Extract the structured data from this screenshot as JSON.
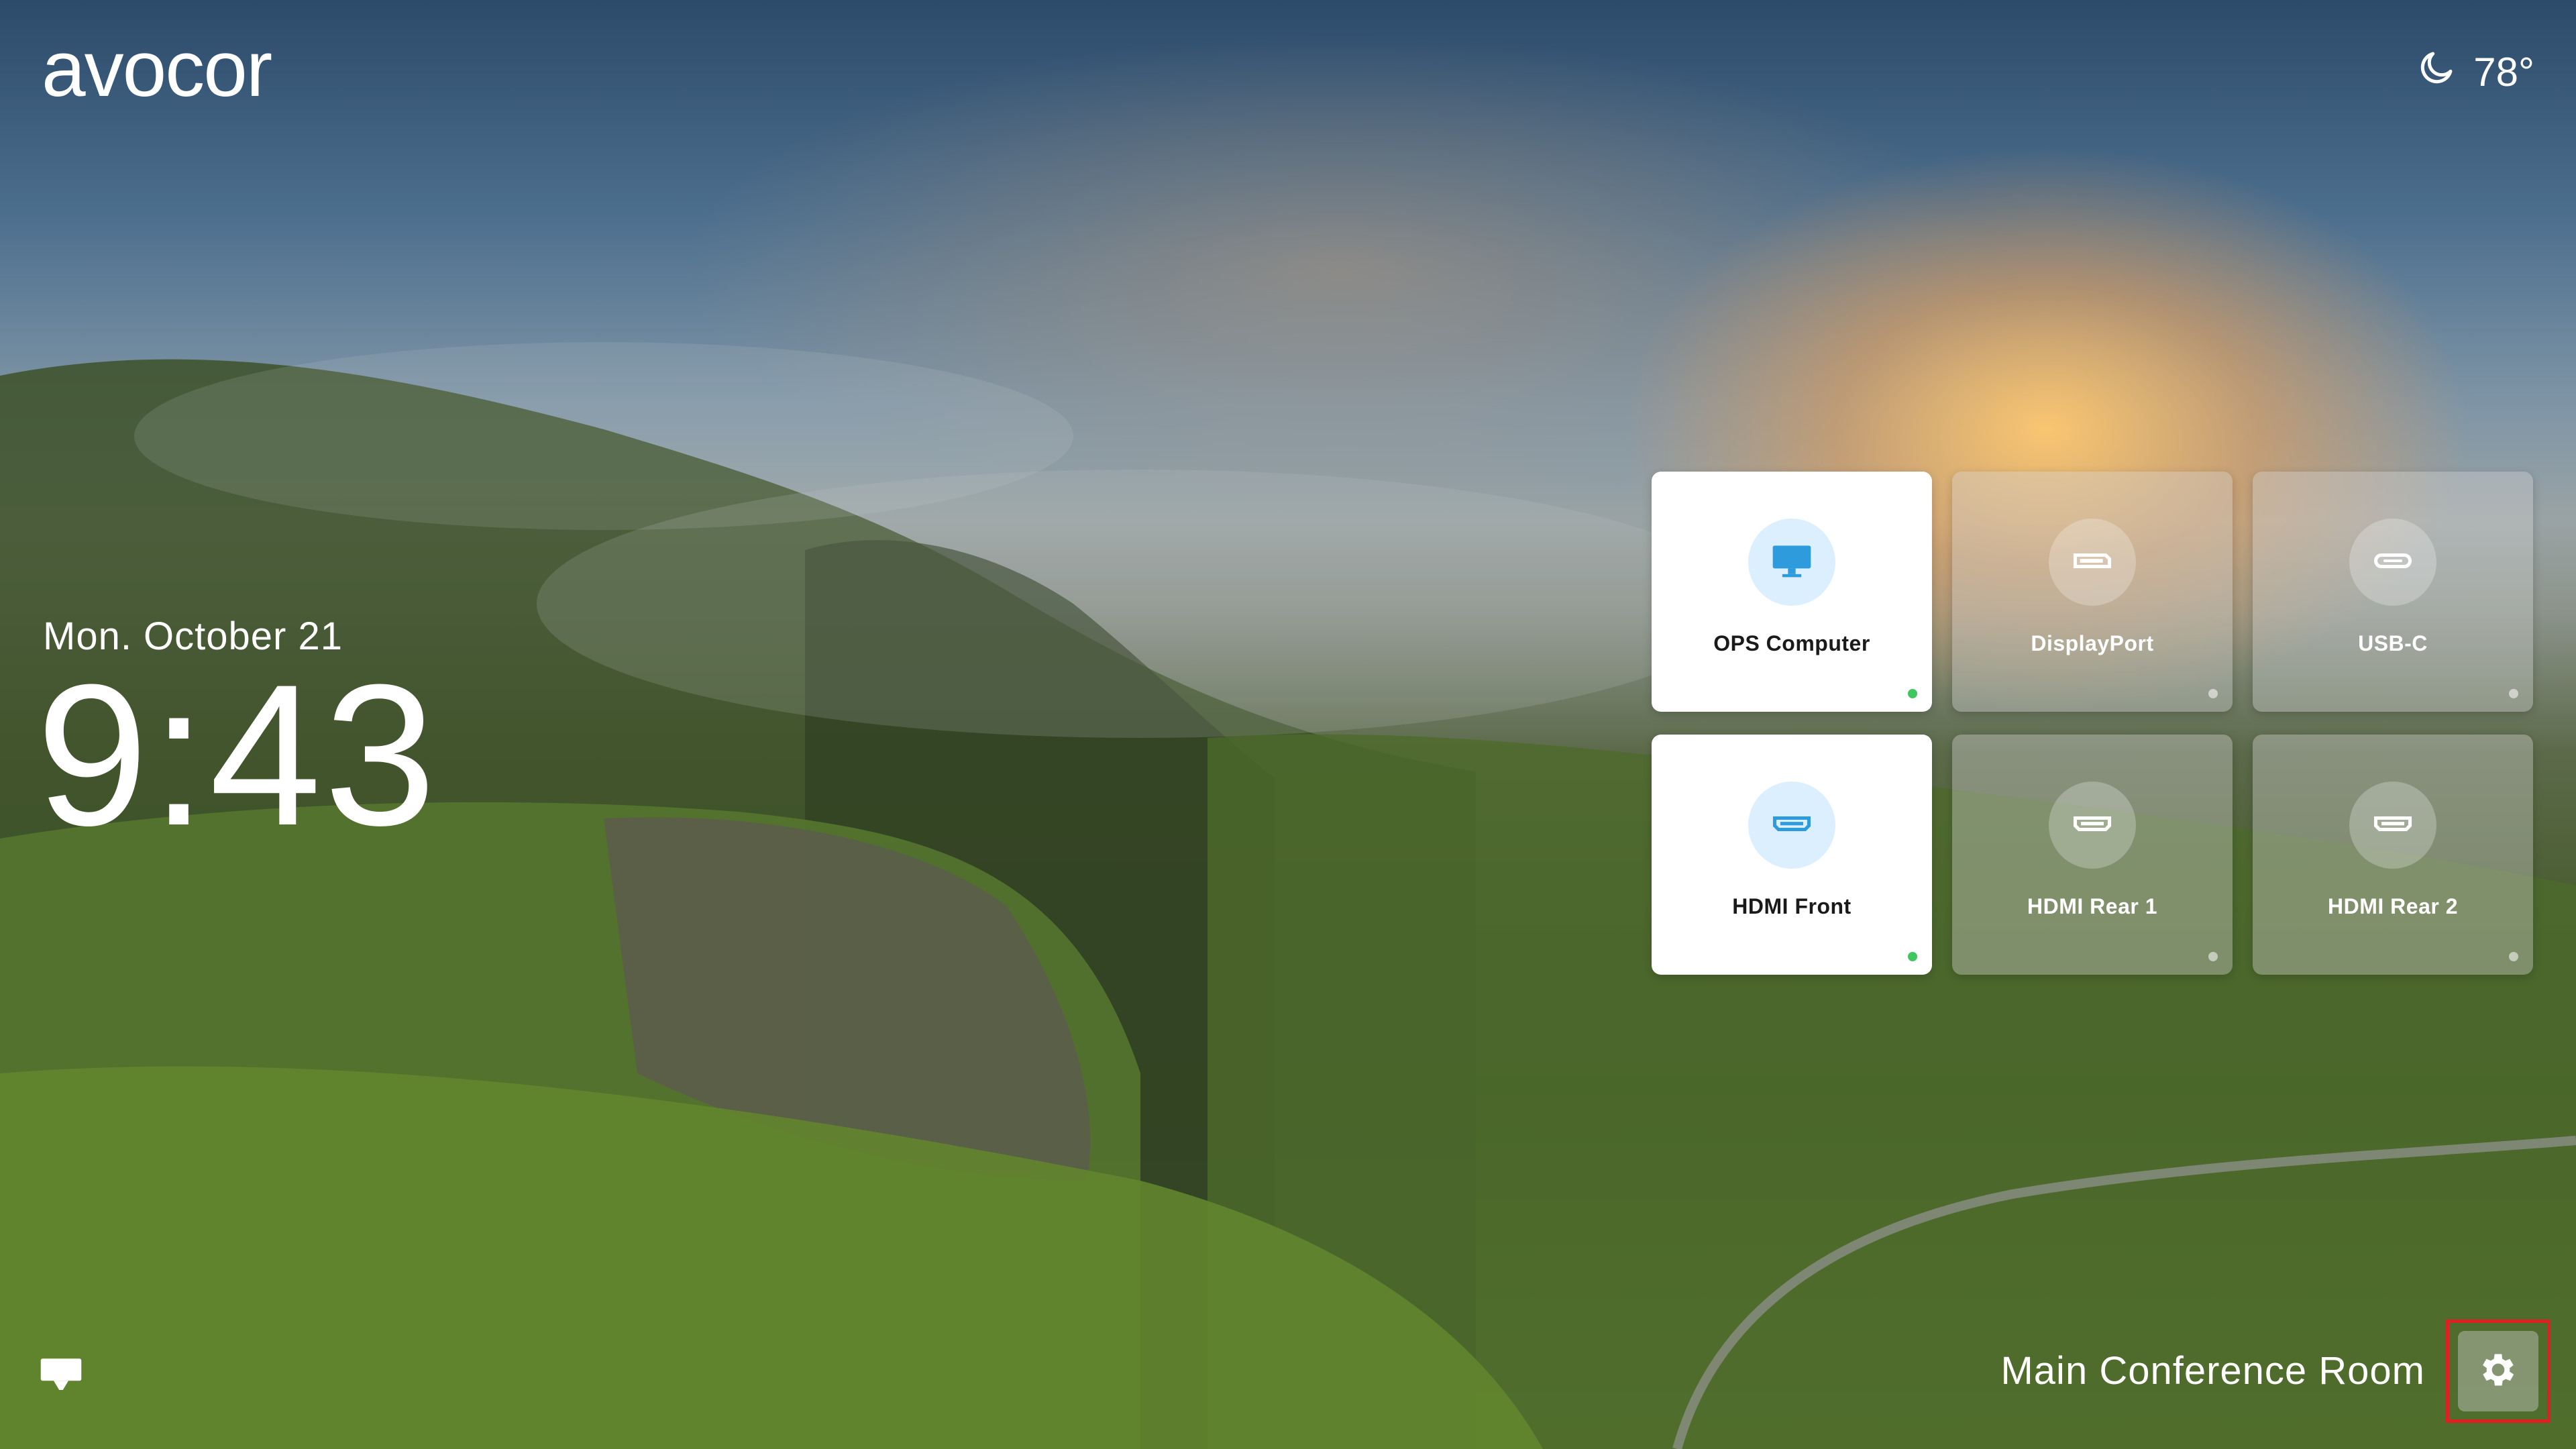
{
  "brand": {
    "logo_text": "avocor"
  },
  "weather": {
    "icon": "moon-icon",
    "temperature": "78°"
  },
  "datetime": {
    "date": "Mon. October 21",
    "time": "9:43"
  },
  "sources": [
    {
      "label": "OPS Computer",
      "icon": "monitor-icon",
      "active": true
    },
    {
      "label": "DisplayPort",
      "icon": "displayport-icon",
      "active": false
    },
    {
      "label": "USB-C",
      "icon": "usb-c-icon",
      "active": false
    },
    {
      "label": "HDMI Front",
      "icon": "hdmi-icon",
      "active": true
    },
    {
      "label": "HDMI Rear 1",
      "icon": "hdmi-icon",
      "active": false
    },
    {
      "label": "HDMI Rear 2",
      "icon": "hdmi-icon",
      "active": false
    }
  ],
  "footer": {
    "room_name": "Main Conference Room",
    "display_icon": "display-icon",
    "settings_icon": "gear-icon"
  },
  "colors": {
    "active_indicator": "#3fc65f",
    "active_icon": "#2e9bdc",
    "highlight_border": "#e02020"
  }
}
